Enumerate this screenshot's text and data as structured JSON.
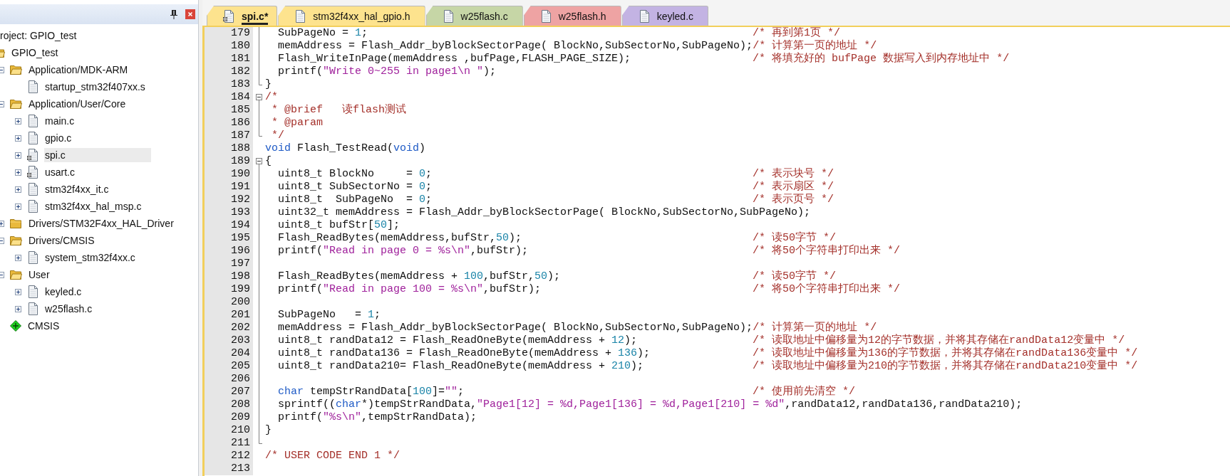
{
  "project_tree": [
    {
      "kind": "project",
      "label": "roject: GPIO_test",
      "selected": false,
      "children": [
        {
          "kind": "target",
          "label": "GPIO_test",
          "expanded": true,
          "selected": false,
          "children": [
            {
              "kind": "folder",
              "label": "Application/MDK-ARM",
              "expanded": true,
              "selected": false,
              "children": [
                {
                  "kind": "file",
                  "label": "startup_stm32f407xx.s",
                  "marked": false,
                  "selected": false
                }
              ]
            },
            {
              "kind": "folder",
              "label": "Application/User/Core",
              "expanded": true,
              "selected": false,
              "children": [
                {
                  "kind": "file",
                  "label": "main.c",
                  "expanded": false,
                  "marked": false,
                  "selected": false
                },
                {
                  "kind": "file",
                  "label": "gpio.c",
                  "expanded": false,
                  "marked": false,
                  "selected": false
                },
                {
                  "kind": "file",
                  "label": "spi.c",
                  "expanded": false,
                  "marked": true,
                  "selected": true
                },
                {
                  "kind": "file",
                  "label": "usart.c",
                  "expanded": false,
                  "marked": true,
                  "selected": false
                },
                {
                  "kind": "file",
                  "label": "stm32f4xx_it.c",
                  "expanded": false,
                  "marked": false,
                  "selected": false
                },
                {
                  "kind": "file",
                  "label": "stm32f4xx_hal_msp.c",
                  "expanded": false,
                  "marked": false,
                  "selected": false
                }
              ]
            },
            {
              "kind": "folder",
              "label": "Drivers/STM32F4xx_HAL_Driver",
              "expanded": false,
              "selected": false
            },
            {
              "kind": "folder",
              "label": "Drivers/CMSIS",
              "expanded": true,
              "selected": false,
              "children": [
                {
                  "kind": "file",
                  "label": "system_stm32f4xx.c",
                  "expanded": false,
                  "marked": false,
                  "selected": false
                }
              ]
            },
            {
              "kind": "folder",
              "label": "User",
              "expanded": true,
              "selected": false,
              "children": [
                {
                  "kind": "file",
                  "label": "keyled.c",
                  "expanded": false,
                  "marked": false,
                  "selected": false
                },
                {
                  "kind": "file",
                  "label": "w25flash.c",
                  "expanded": false,
                  "marked": false,
                  "selected": false
                }
              ]
            },
            {
              "kind": "component",
              "label": "CMSIS",
              "selected": false
            }
          ]
        }
      ]
    }
  ],
  "editor": {
    "tabs": [
      {
        "label": "spi.c*",
        "color": "#fde38e",
        "selected": true,
        "marked": true
      },
      {
        "label": "stm32f4xx_hal_gpio.h",
        "color": "#fde38e",
        "selected": false,
        "marked": false
      },
      {
        "label": "w25flash.c",
        "color": "#c6d6a6",
        "selected": false,
        "marked": false
      },
      {
        "label": "w25flash.h",
        "color": "#eea3a3",
        "selected": false,
        "marked": false
      },
      {
        "label": "keyled.c",
        "color": "#c3b3e3",
        "selected": false,
        "marked": false
      }
    ],
    "lines": [
      {
        "number": "179",
        "kind": "bar",
        "code": [
          {
            "kind": "plain",
            "text": "  SubPageNo = "
          },
          {
            "kind": "number",
            "text": "1"
          },
          {
            "kind": "plain",
            "text": ";"
          }
        ],
        "comment": "/* 再到第1页 */"
      },
      {
        "number": "180",
        "kind": "bar",
        "code": [
          {
            "kind": "plain",
            "text": "  memAddress = Flash_Addr_byBlockSectorPage( BlockNo,SubSectorNo,SubPageNo);"
          }
        ],
        "comment": "/* 计算第一页的地址 */"
      },
      {
        "number": "181",
        "kind": "bar",
        "code": [
          {
            "kind": "plain",
            "text": "  Flash_WriteInPage(memAddress ,bufPage,FLASH_PAGE_SIZE);"
          }
        ],
        "comment": "/* 将填充好的 bufPage 数据写入到内存地址中 */"
      },
      {
        "number": "182",
        "kind": "bar",
        "code": [
          {
            "kind": "plain",
            "text": "  printf("
          },
          {
            "kind": "string",
            "text": "\"Write 0~255 in page1\\n \""
          },
          {
            "kind": "plain",
            "text": ");"
          }
        ]
      },
      {
        "number": "183",
        "kind": "end",
        "code": [
          {
            "kind": "plain",
            "text": "}"
          }
        ]
      },
      {
        "number": "184",
        "kind": "open",
        "code": [
          {
            "kind": "comment",
            "text": "/*"
          }
        ]
      },
      {
        "number": "185",
        "kind": "bar",
        "code": [
          {
            "kind": "comment",
            "text": " * @brief   读flash测试"
          }
        ]
      },
      {
        "number": "186",
        "kind": "bar",
        "code": [
          {
            "kind": "comment",
            "text": " * @param"
          }
        ]
      },
      {
        "number": "187",
        "kind": "end",
        "code": [
          {
            "kind": "comment",
            "text": " */"
          }
        ]
      },
      {
        "number": "188",
        "code": [
          {
            "kind": "keyword",
            "text": "void"
          },
          {
            "kind": "plain",
            "text": " Flash_TestRead("
          },
          {
            "kind": "keyword",
            "text": "void"
          },
          {
            "kind": "plain",
            "text": ")"
          }
        ]
      },
      {
        "number": "189",
        "kind": "open",
        "code": [
          {
            "kind": "plain",
            "text": "{"
          }
        ]
      },
      {
        "number": "190",
        "kind": "bar",
        "code": [
          {
            "kind": "plain",
            "text": "  uint8_t BlockNo     = "
          },
          {
            "kind": "number",
            "text": "0"
          },
          {
            "kind": "plain",
            "text": ";"
          }
        ],
        "comment": "/* 表示块号 */"
      },
      {
        "number": "191",
        "kind": "bar",
        "code": [
          {
            "kind": "plain",
            "text": "  uint8_t SubSectorNo = "
          },
          {
            "kind": "number",
            "text": "0"
          },
          {
            "kind": "plain",
            "text": ";"
          }
        ],
        "comment": "/* 表示扇区 */"
      },
      {
        "number": "192",
        "kind": "bar",
        "code": [
          {
            "kind": "plain",
            "text": "  uint8_t  SubPageNo  = "
          },
          {
            "kind": "number",
            "text": "0"
          },
          {
            "kind": "plain",
            "text": ";"
          }
        ],
        "comment": "/* 表示页号 */"
      },
      {
        "number": "193",
        "kind": "bar",
        "code": [
          {
            "kind": "plain",
            "text": "  uint32_t memAddress = Flash_Addr_byBlockSectorPage( BlockNo,SubSectorNo,SubPageNo);"
          }
        ]
      },
      {
        "number": "194",
        "kind": "bar",
        "code": [
          {
            "kind": "plain",
            "text": "  uint8_t bufStr["
          },
          {
            "kind": "number",
            "text": "50"
          },
          {
            "kind": "plain",
            "text": "];"
          }
        ]
      },
      {
        "number": "195",
        "kind": "bar",
        "code": [
          {
            "kind": "plain",
            "text": "  Flash_ReadBytes(memAddress,bufStr,"
          },
          {
            "kind": "number",
            "text": "50"
          },
          {
            "kind": "plain",
            "text": ");"
          }
        ],
        "comment": "/* 读50字节 */"
      },
      {
        "number": "196",
        "kind": "bar",
        "code": [
          {
            "kind": "plain",
            "text": "  printf("
          },
          {
            "kind": "string",
            "text": "\"Read in page 0 = %s\\n\""
          },
          {
            "kind": "plain",
            "text": ",bufStr);"
          }
        ],
        "comment": "/* 将50个字符串打印出来 */"
      },
      {
        "number": "197",
        "kind": "bar"
      },
      {
        "number": "198",
        "kind": "bar",
        "code": [
          {
            "kind": "plain",
            "text": "  Flash_ReadBytes(memAddress + "
          },
          {
            "kind": "number",
            "text": "100"
          },
          {
            "kind": "plain",
            "text": ",bufStr,"
          },
          {
            "kind": "number",
            "text": "50"
          },
          {
            "kind": "plain",
            "text": ");"
          }
        ],
        "comment": "/* 读50字节 */"
      },
      {
        "number": "199",
        "kind": "bar",
        "code": [
          {
            "kind": "plain",
            "text": "  printf("
          },
          {
            "kind": "string",
            "text": "\"Read in page 100 = %s\\n\""
          },
          {
            "kind": "plain",
            "text": ",bufStr);"
          }
        ],
        "comment": "/* 将50个字符串打印出来 */"
      },
      {
        "number": "200",
        "kind": "bar"
      },
      {
        "number": "201",
        "kind": "bar",
        "code": [
          {
            "kind": "plain",
            "text": "  SubPageNo   = "
          },
          {
            "kind": "number",
            "text": "1"
          },
          {
            "kind": "plain",
            "text": ";"
          }
        ]
      },
      {
        "number": "202",
        "kind": "bar",
        "code": [
          {
            "kind": "plain",
            "text": "  memAddress = Flash_Addr_byBlockSectorPage( BlockNo,SubSectorNo,SubPageNo);"
          }
        ],
        "comment": "/* 计算第一页的地址 */"
      },
      {
        "number": "203",
        "kind": "bar",
        "code": [
          {
            "kind": "plain",
            "text": "  uint8_t randData12 = Flash_ReadOneByte(memAddress + "
          },
          {
            "kind": "number",
            "text": "12"
          },
          {
            "kind": "plain",
            "text": ");"
          }
        ],
        "comment": "/* 读取地址中偏移量为12的字节数据，并将其存储在randData12变量中 */"
      },
      {
        "number": "204",
        "kind": "bar",
        "code": [
          {
            "kind": "plain",
            "text": "  uint8_t randData136 = Flash_ReadOneByte(memAddress + "
          },
          {
            "kind": "number",
            "text": "136"
          },
          {
            "kind": "plain",
            "text": ");"
          }
        ],
        "comment": "/* 读取地址中偏移量为136的字节数据，并将其存储在randData136变量中 */"
      },
      {
        "number": "205",
        "kind": "bar",
        "code": [
          {
            "kind": "plain",
            "text": "  uint8_t randData210= Flash_ReadOneByte(memAddress + "
          },
          {
            "kind": "number",
            "text": "210"
          },
          {
            "kind": "plain",
            "text": ");"
          }
        ],
        "comment": "/* 读取地址中偏移量为210的字节数据，并将其存储在randData210变量中 */"
      },
      {
        "number": "206",
        "kind": "bar"
      },
      {
        "number": "207",
        "kind": "bar",
        "code": [
          {
            "kind": "keyword",
            "text": "  char"
          },
          {
            "kind": "plain",
            "text": " tempStrRandData["
          },
          {
            "kind": "number",
            "text": "100"
          },
          {
            "kind": "plain",
            "text": "]="
          },
          {
            "kind": "string",
            "text": "\"\""
          },
          {
            "kind": "plain",
            "text": ";"
          }
        ],
        "comment": "/* 使用前先清空 */"
      },
      {
        "number": "208",
        "kind": "bar",
        "code": [
          {
            "kind": "plain",
            "text": "  sprintf(("
          },
          {
            "kind": "keyword",
            "text": "char"
          },
          {
            "kind": "plain",
            "text": "*)tempStrRandData,"
          },
          {
            "kind": "string",
            "text": "\"Page1[12] = %d,Page1[136] = %d,Page1[210] = %d\""
          },
          {
            "kind": "plain",
            "text": ",randData12,randData136,randData210);"
          }
        ]
      },
      {
        "number": "209",
        "kind": "bar",
        "code": [
          {
            "kind": "plain",
            "text": "  printf("
          },
          {
            "kind": "string",
            "text": "\"%s\\n\""
          },
          {
            "kind": "plain",
            "text": ",tempStrRandData);"
          }
        ]
      },
      {
        "number": "210",
        "kind": "bar",
        "code": [
          {
            "kind": "plain",
            "text": "}"
          }
        ]
      },
      {
        "number": "211",
        "kind": "end"
      },
      {
        "number": "212",
        "code": [
          {
            "kind": "comment",
            "text": "/* USER CODE END 1 */"
          }
        ]
      },
      {
        "number": "213"
      }
    ]
  }
}
